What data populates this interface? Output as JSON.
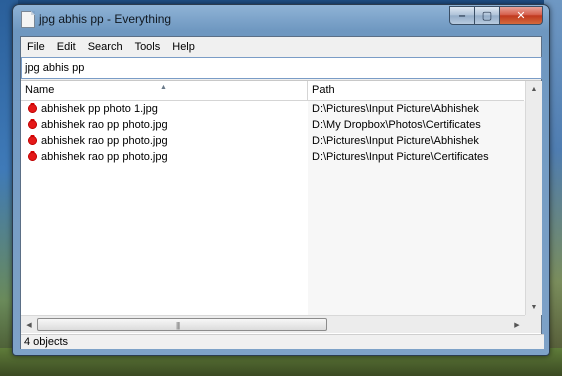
{
  "window": {
    "title": "jpg abhis pp - Everything",
    "buttons": {
      "minimize": "‒",
      "maximize": "▢",
      "close": "✕"
    }
  },
  "menu": [
    "File",
    "Edit",
    "Search",
    "Tools",
    "Help"
  ],
  "search": {
    "value": "jpg abhis pp"
  },
  "columns": {
    "name": "Name",
    "path": "Path"
  },
  "rows": [
    {
      "name": "abhishek pp photo 1.jpg",
      "path": "D:\\Pictures\\Input Picture\\Abhishek"
    },
    {
      "name": "abhishek rao pp photo.jpg",
      "path": "D:\\My Dropbox\\Photos\\Certificates"
    },
    {
      "name": "abhishek rao pp photo.jpg",
      "path": "D:\\Pictures\\Input Picture\\Abhishek"
    },
    {
      "name": "abhishek rao pp photo.jpg",
      "path": "D:\\Pictures\\Input Picture\\Certificates"
    }
  ],
  "status": {
    "text": "4 objects"
  }
}
